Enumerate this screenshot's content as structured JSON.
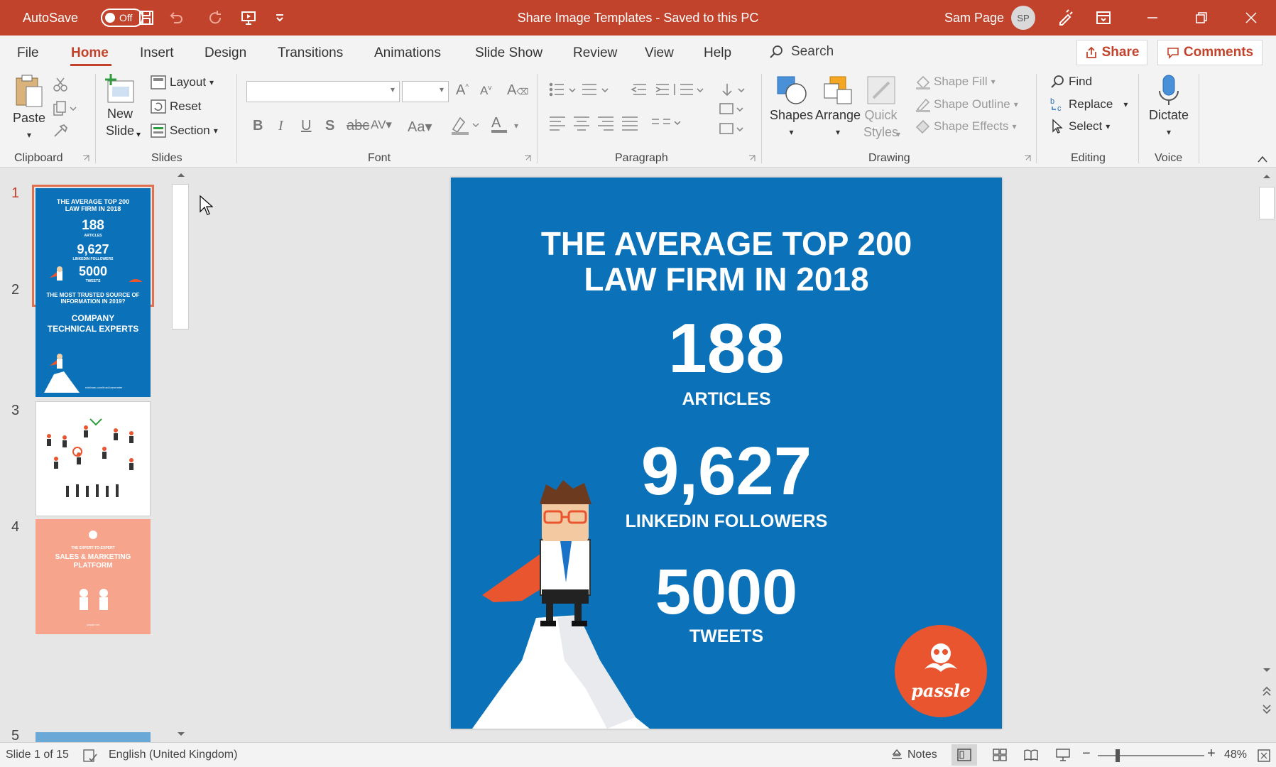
{
  "titlebar": {
    "autosave_label": "AutoSave",
    "autosave_state": "Off",
    "document_title": "Share Image Templates  -  Saved to this PC",
    "user_name": "Sam Page",
    "user_initials": "SP"
  },
  "menu": {
    "tabs": [
      "File",
      "Home",
      "Insert",
      "Design",
      "Transitions",
      "Animations",
      "Slide Show",
      "Review",
      "View",
      "Help"
    ],
    "active_tab": "Home",
    "search_label": "Search",
    "share_label": "Share",
    "comments_label": "Comments"
  },
  "ribbon": {
    "clipboard": {
      "paste": "Paste",
      "label": "Clipboard"
    },
    "slides": {
      "new_slide_1": "New",
      "new_slide_2": "Slide",
      "layout": "Layout",
      "reset": "Reset",
      "section": "Section",
      "label": "Slides"
    },
    "font": {
      "label": "Font",
      "font_name": "",
      "font_size": ""
    },
    "paragraph": {
      "label": "Paragraph"
    },
    "drawing": {
      "shapes": "Shapes",
      "arrange": "Arrange",
      "quick_styles_1": "Quick",
      "quick_styles_2": "Styles",
      "shape_fill": "Shape Fill",
      "shape_outline": "Shape Outline",
      "shape_effects": "Shape Effects",
      "label": "Drawing"
    },
    "editing": {
      "find": "Find",
      "replace": "Replace",
      "select": "Select",
      "label": "Editing"
    },
    "voice": {
      "dictate": "Dictate",
      "label": "Voice"
    }
  },
  "thumbnails": [
    {
      "num": "1",
      "lines": [
        "THE AVERAGE TOP 200",
        "LAW FIRM IN 2018",
        "188",
        "ARTICLES",
        "9,627",
        "LINKEDIN FOLLOWERS",
        "5000",
        "TWEETS"
      ]
    },
    {
      "num": "2",
      "lines": [
        "THE MOST TRUSTED SOURCE OF",
        "INFORMATION IN 2019?",
        "COMPANY",
        "TECHNICAL EXPERTS",
        "edelman.com/trust-barometer"
      ]
    },
    {
      "num": "3"
    },
    {
      "num": "4",
      "lines": [
        "THE EXPERT-TO-EXPERT",
        "SALES & MARKETING",
        "PLATFORM",
        "passle.net"
      ]
    },
    {
      "num": "5"
    }
  ],
  "slide": {
    "title_line1": "THE AVERAGE TOP 200",
    "title_line2": "LAW FIRM IN 2018",
    "stat1_value": "188",
    "stat1_label": "ARTICLES",
    "stat2_value": "9,627",
    "stat2_label": "LINKEDIN FOLLOWERS",
    "stat3_value": "5000",
    "stat3_label": "TWEETS",
    "logo_text": "passle"
  },
  "colors": {
    "accent": "#c2432b",
    "slide_bg": "#0b72b9",
    "logo": "#e9552f"
  },
  "statusbar": {
    "slide_counter": "Slide 1 of 15",
    "language": "English (United Kingdom)",
    "notes": "Notes",
    "zoom": "48%"
  }
}
